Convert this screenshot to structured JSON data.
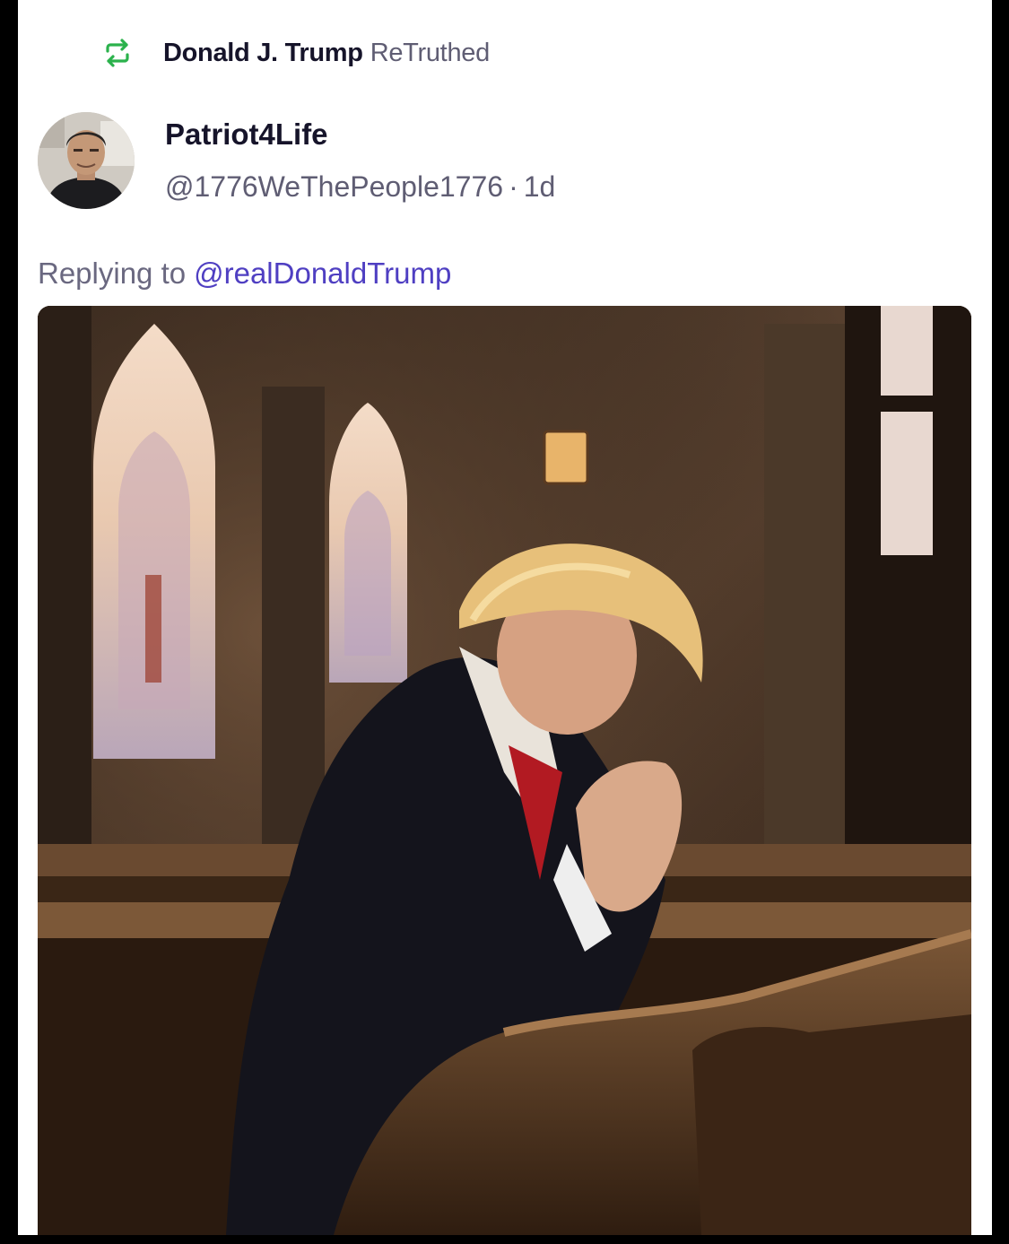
{
  "retruth": {
    "icon": "retruth-icon",
    "name": "Donald J. Trump",
    "action": "ReTruthed",
    "icon_color": "#2bb24c"
  },
  "post": {
    "author_name": "Patriot4Life",
    "author_handle": "@1776WeThePeople1776",
    "separator": "·",
    "age": "1d",
    "reply_prefix": "Replying to",
    "reply_to": "@realDonaldTrump",
    "link_color": "#4f3fc2",
    "image_subject": "man in dark suit and red tie praying in a church pew beside stained glass windows"
  }
}
